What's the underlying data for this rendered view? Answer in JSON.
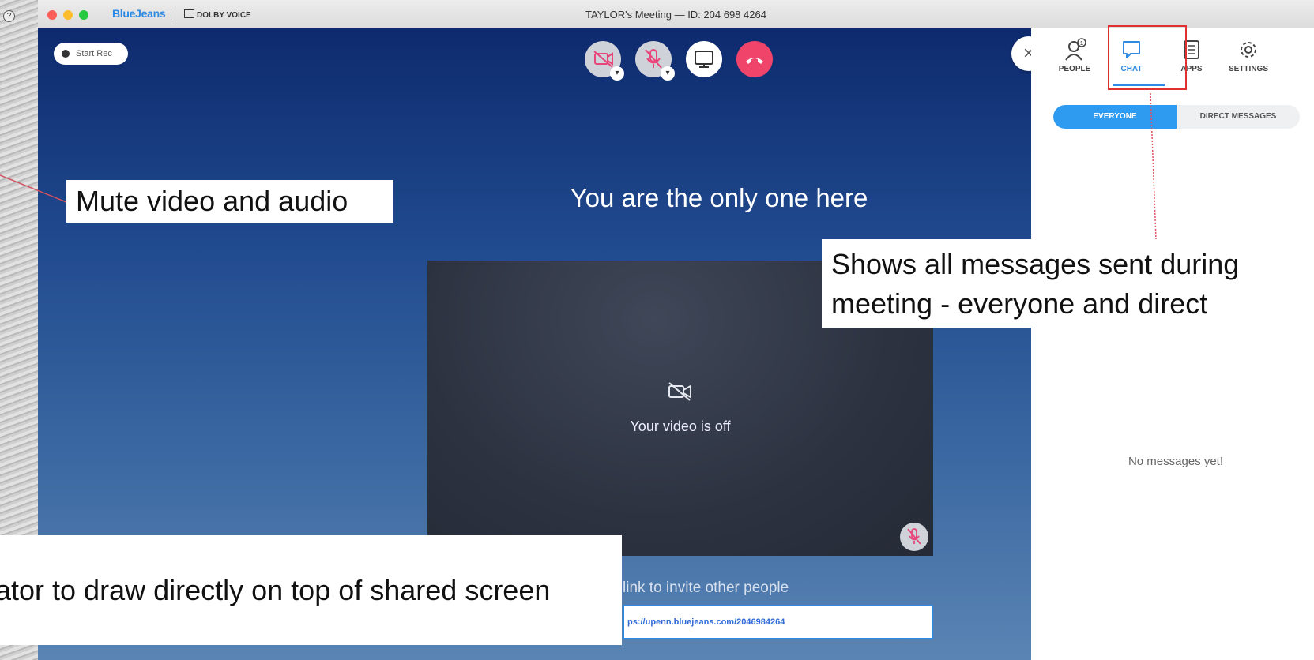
{
  "window": {
    "brand": "BlueJeans",
    "partner": "DOLBY VOICE",
    "title": "TAYLOR's Meeting — ID: 204 698 4264"
  },
  "stage": {
    "start_rec_label": "Start Rec",
    "only_one_text": "You are the only one here",
    "video_off_text": "Your video is off",
    "invite_text": "link to invite other people",
    "invite_link": "ps://upenn.bluejeans.com/2046984264"
  },
  "controls": {
    "camera": "camera-off-icon",
    "mic": "mic-off-icon",
    "share": "screen-share-icon",
    "end": "end-call-icon"
  },
  "sidebar": {
    "tabs": [
      {
        "label": "PEOPLE",
        "icon": "person-icon"
      },
      {
        "label": "CHAT",
        "icon": "chat-bubble-icon",
        "active": true
      },
      {
        "label": "APPS",
        "icon": "apps-icon"
      },
      {
        "label": "SETTINGS",
        "icon": "gear-icon"
      }
    ],
    "people_count": "1",
    "segments": {
      "everyone": "EVERYONE",
      "direct": "DIRECT MESSAGES"
    },
    "empty_text": "No messages yet!"
  },
  "annotations": {
    "mute": "Mute video and audio",
    "messages_line1": "Shows all messages sent during",
    "messages_line2": "meeting - everyone and direct",
    "draw": "ator to draw directly on top of shared screen"
  },
  "colors": {
    "accent": "#2f8ae3",
    "end_call": "#f0446a",
    "highlight": "#e03030"
  }
}
